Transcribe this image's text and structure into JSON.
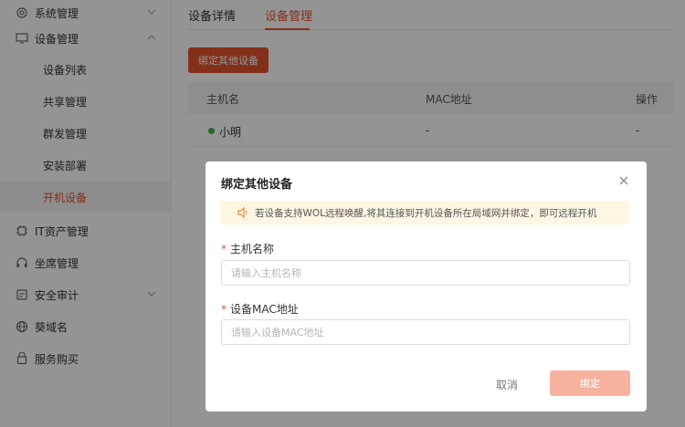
{
  "sidebar": {
    "items": [
      {
        "label": "系统管理",
        "icon": "gear-icon"
      },
      {
        "label": "设备管理",
        "icon": "monitor-icon"
      },
      {
        "label": "设备列表"
      },
      {
        "label": "共享管理"
      },
      {
        "label": "群发管理"
      },
      {
        "label": "安装部署"
      },
      {
        "label": "开机设备"
      },
      {
        "label": "IT资产管理",
        "icon": "chip-icon"
      },
      {
        "label": "坐席管理",
        "icon": "headset-icon"
      },
      {
        "label": "安全审计",
        "icon": "shield-icon"
      },
      {
        "label": "葵域名",
        "icon": "globe-icon"
      },
      {
        "label": "服务购买",
        "icon": "bag-icon"
      }
    ]
  },
  "tabs": [
    {
      "label": "设备详情"
    },
    {
      "label": "设备管理"
    }
  ],
  "bind_button": "绑定其他设备",
  "table": {
    "headers": [
      "主机名",
      "MAC地址",
      "操作"
    ],
    "rows": [
      {
        "name": "小明",
        "mac": "-",
        "action": "-"
      }
    ]
  },
  "modal": {
    "title": "绑定其他设备",
    "notice": "若设备支持WOL远程唤醒,将其连接到开机设备所在局域网并绑定，即可远程开机",
    "host_label": "主机名称",
    "host_placeholder": "请输入主机名称",
    "mac_label": "设备MAC地址",
    "mac_placeholder": "请输入设备MAC地址",
    "cancel": "取消",
    "confirm": "绑定"
  },
  "colors": {
    "accent": "#e2542f",
    "accent_disabled": "#f6b29e",
    "online": "#4caf50",
    "notice_bg": "#fdf6e3"
  }
}
